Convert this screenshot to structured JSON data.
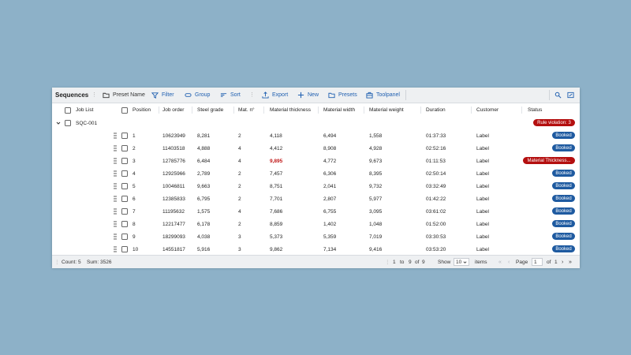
{
  "toolbar": {
    "title": "Sequences",
    "preset_name": "Preset Name",
    "filter": "Filter",
    "group": "Group",
    "sort": "Sort",
    "export": "Export",
    "new": "New",
    "presets": "Presets",
    "toolpanel": "Toolpanel"
  },
  "columns": [
    "Job List",
    "Position",
    "Job order",
    "Steel grade",
    "Mat. n°",
    "Material thickness",
    "Material width",
    "Material weight",
    "Duration",
    "Customer",
    "Status"
  ],
  "group": {
    "label": "SQC-001",
    "badge": "Rule violation: 3"
  },
  "rows": [
    {
      "position": "1",
      "job_order": "10623949",
      "steel_grade": "8,281",
      "mat_no": "2",
      "thickness": "4,118",
      "width": "6,494",
      "weight": "1,558",
      "duration": "01:37:33",
      "customer": "Label",
      "status": "Booked",
      "status_type": "booked",
      "thickness_flag": false
    },
    {
      "position": "2",
      "job_order": "11403518",
      "steel_grade": "4,888",
      "mat_no": "4",
      "thickness": "4,412",
      "width": "8,908",
      "weight": "4,928",
      "duration": "02:52:16",
      "customer": "Label",
      "status": "Booked",
      "status_type": "booked",
      "thickness_flag": false
    },
    {
      "position": "3",
      "job_order": "12785776",
      "steel_grade": "6,484",
      "mat_no": "4",
      "thickness": "9,895",
      "width": "4,772",
      "weight": "9,673",
      "duration": "01:11:53",
      "customer": "Label",
      "status": "Material Thickness...",
      "status_type": "error",
      "thickness_flag": true
    },
    {
      "position": "4",
      "job_order": "12925966",
      "steel_grade": "2,789",
      "mat_no": "2",
      "thickness": "7,457",
      "width": "6,306",
      "weight": "8,395",
      "duration": "02:50:14",
      "customer": "Label",
      "status": "Booked",
      "status_type": "booked",
      "thickness_flag": false
    },
    {
      "position": "5",
      "job_order": "10046811",
      "steel_grade": "9,663",
      "mat_no": "2",
      "thickness": "8,751",
      "width": "2,041",
      "weight": "9,732",
      "duration": "03:32:49",
      "customer": "Label",
      "status": "Booked",
      "status_type": "booked",
      "thickness_flag": false
    },
    {
      "position": "6",
      "job_order": "12385833",
      "steel_grade": "6,795",
      "mat_no": "2",
      "thickness": "7,701",
      "width": "2,807",
      "weight": "5,977",
      "duration": "01:42:22",
      "customer": "Label",
      "status": "Booked",
      "status_type": "booked",
      "thickness_flag": false
    },
    {
      "position": "7",
      "job_order": "11195632",
      "steel_grade": "1,575",
      "mat_no": "4",
      "thickness": "7,686",
      "width": "6,755",
      "weight": "3,095",
      "duration": "03:61:02",
      "customer": "Label",
      "status": "Booked",
      "status_type": "booked",
      "thickness_flag": false
    },
    {
      "position": "8",
      "job_order": "12217477",
      "steel_grade": "6,178",
      "mat_no": "2",
      "thickness": "8,859",
      "width": "1,402",
      "weight": "1,048",
      "duration": "01:52:00",
      "customer": "Label",
      "status": "Booked",
      "status_type": "booked",
      "thickness_flag": false
    },
    {
      "position": "9",
      "job_order": "18299093",
      "steel_grade": "4,038",
      "mat_no": "3",
      "thickness": "5,373",
      "width": "5,359",
      "weight": "7,019",
      "duration": "03:30:53",
      "customer": "Label",
      "status": "Booked",
      "status_type": "booked",
      "thickness_flag": false
    },
    {
      "position": "10",
      "job_order": "14551817",
      "steel_grade": "5,916",
      "mat_no": "3",
      "thickness": "9,862",
      "width": "7,134",
      "weight": "9,416",
      "duration": "03:53:20",
      "customer": "Label",
      "status": "Booked",
      "status_type": "booked",
      "thickness_flag": false
    }
  ],
  "footer": {
    "count": "Count: 5",
    "sum": "Sum: 3526",
    "range_start": "1",
    "to": "to",
    "range_end": "9",
    "of": "of",
    "total": "9",
    "show": "Show",
    "page_size": "10",
    "items": "items",
    "page_label": "Page",
    "page_value": "1",
    "of_pages": "of",
    "page_total": "1"
  },
  "colors": {
    "booked": "#1e5aa0",
    "error": "#b40f0f",
    "accent": "#1f5fb0",
    "background": "#8db1c8"
  }
}
